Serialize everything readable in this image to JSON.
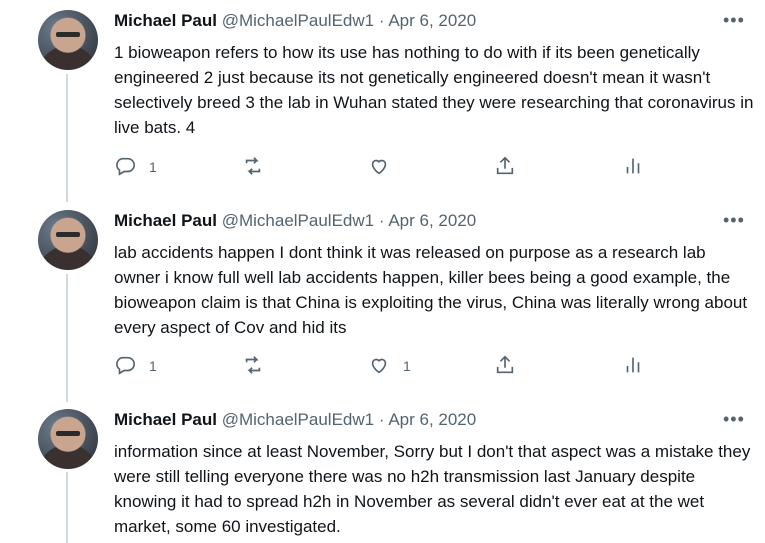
{
  "tweets": [
    {
      "name": "Michael Paul",
      "handle": "@MichaelPaulEdw1",
      "separator": "·",
      "date": "Apr 6, 2020",
      "more": "•••",
      "text": "1 bioweapon refers to how its use has nothing to do with if its been genetically engineered 2 just because its not genetically engineered doesn't mean it wasn't selectively breed 3 the lab in Wuhan stated they were researching that coronavirus in live bats. 4",
      "replies": "1",
      "retweets": "",
      "likes": ""
    },
    {
      "name": "Michael Paul",
      "handle": "@MichaelPaulEdw1",
      "separator": "·",
      "date": "Apr 6, 2020",
      "more": "•••",
      "text": "lab accidents happen I dont think it was released on purpose as a research lab owner i know full well lab accidents happen, killer bees being a good example, the bioweapon claim is that China is exploiting the virus, China was literally wrong about every aspect of Cov and hid its",
      "replies": "1",
      "retweets": "",
      "likes": "1"
    },
    {
      "name": "Michael Paul",
      "handle": "@MichaelPaulEdw1",
      "separator": "·",
      "date": "Apr 6, 2020",
      "more": "•••",
      "text": "information since at least November, Sorry but I don't that aspect was a mistake they were still telling everyone there was no h2h transmission last January despite knowing it had to spread h2h in November as several didn't ever eat at the wet market, some 60 investigated."
    }
  ],
  "colors": {
    "text": "#0f1419",
    "secondary": "#536471",
    "thread_line": "#cfd9de"
  }
}
